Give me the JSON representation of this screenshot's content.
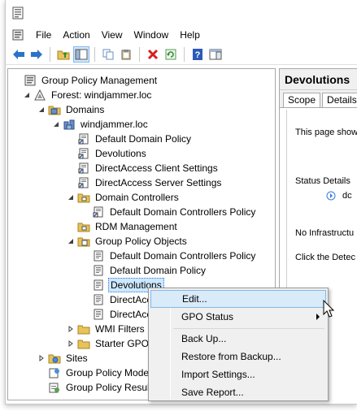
{
  "menubar": {
    "items": [
      "File",
      "Action",
      "View",
      "Window",
      "Help"
    ]
  },
  "tree": {
    "items": [
      {
        "label": "Group Policy Management",
        "icon": "gpmc-icon"
      },
      {
        "label": "Forest: windjammer.loc",
        "icon": "forest-icon"
      },
      {
        "label": "Domains",
        "icon": "domains-icon"
      },
      {
        "label": "windjammer.loc",
        "icon": "domain-icon"
      },
      {
        "label": "Default Domain Policy",
        "icon": "gpo-link-icon"
      },
      {
        "label": "Devolutions",
        "icon": "gpo-link-icon"
      },
      {
        "label": "DirectAccess Client Settings",
        "icon": "gpo-link-icon"
      },
      {
        "label": "DirectAccess Server Settings",
        "icon": "gpo-link-icon"
      },
      {
        "label": "Domain Controllers",
        "icon": "ou-icon"
      },
      {
        "label": "Default Domain Controllers Policy",
        "icon": "gpo-link-icon"
      },
      {
        "label": "RDM Management",
        "icon": "ou-icon"
      },
      {
        "label": "Group Policy Objects",
        "icon": "gpo-folder-icon"
      },
      {
        "label": "Default Domain Controllers Policy",
        "icon": "gpo-icon"
      },
      {
        "label": "Default Domain Policy",
        "icon": "gpo-icon"
      },
      {
        "label": "Devolutions",
        "icon": "gpo-icon"
      },
      {
        "label": "DirectAcce",
        "icon": "gpo-icon"
      },
      {
        "label": "DirectAcce",
        "icon": "gpo-icon"
      },
      {
        "label": "WMI Filters",
        "icon": "folder-icon"
      },
      {
        "label": "Starter GPOs",
        "icon": "folder-icon"
      },
      {
        "label": "Sites",
        "icon": "sites-icon"
      },
      {
        "label": "Group Policy Modelin",
        "icon": "modeling-icon"
      },
      {
        "label": "Group Policy Results",
        "icon": "results-icon"
      }
    ]
  },
  "right_pane": {
    "title": "Devolutions",
    "tabs": [
      "Scope",
      "Details",
      "S"
    ],
    "text_this_page": "This page shows",
    "status_details": "Status Details",
    "status_dc": "dc",
    "no_infra": "No Infrastructu",
    "click_detect": "Click the Detec"
  },
  "context_menu": {
    "items": [
      "Edit...",
      "GPO Status",
      "Back Up...",
      "Restore from Backup...",
      "Import Settings...",
      "Save Report..."
    ]
  },
  "colors": {
    "selection": "#cde8ff",
    "menu_hover": "#d9ebf9",
    "menu_hover_border": "#84b7e7"
  }
}
